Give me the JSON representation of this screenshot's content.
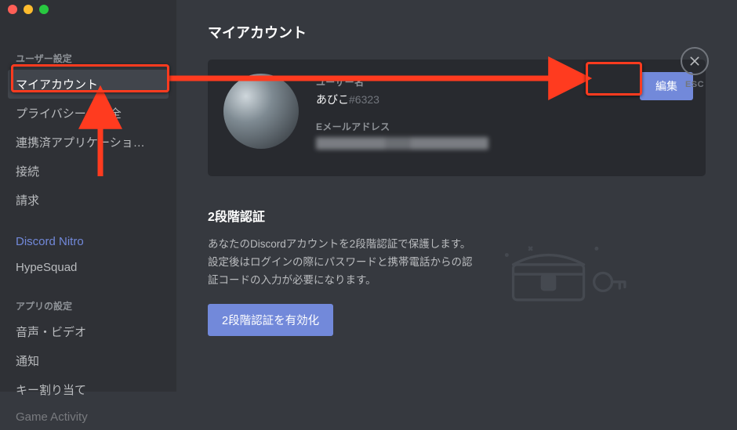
{
  "titlebar": {
    "close": "",
    "minimize": "",
    "zoom": ""
  },
  "sidebar": {
    "header_user": "ユーザー設定",
    "my_account": "マイアカウント",
    "privacy": "プライバシー・安全",
    "authorized_apps": "連携済アプリケーショ…",
    "connections": "接続",
    "billing": "請求",
    "nitro": "Discord Nitro",
    "hypesquad": "HypeSquad",
    "header_app": "アプリの設定",
    "voice_video": "音声・ビデオ",
    "notifications": "通知",
    "keybinds": "キー割り当て",
    "game_activity": "Game Activity"
  },
  "content": {
    "title": "マイアカウント",
    "username_label": "ユーザー名",
    "username": "あびこ",
    "discriminator": "#6323",
    "email_label": "Eメールアドレス",
    "email_value": "(hidden)",
    "edit": "編集"
  },
  "twofa": {
    "title": "2段階認証",
    "desc": "あなたのDiscordアカウントを2段階認証で保護します。設定後はログインの際にパスワードと携帯電話からの認証コードの入力が必要になります。",
    "enable": "2段階認証を有効化"
  },
  "esc": {
    "label": "ESC"
  }
}
